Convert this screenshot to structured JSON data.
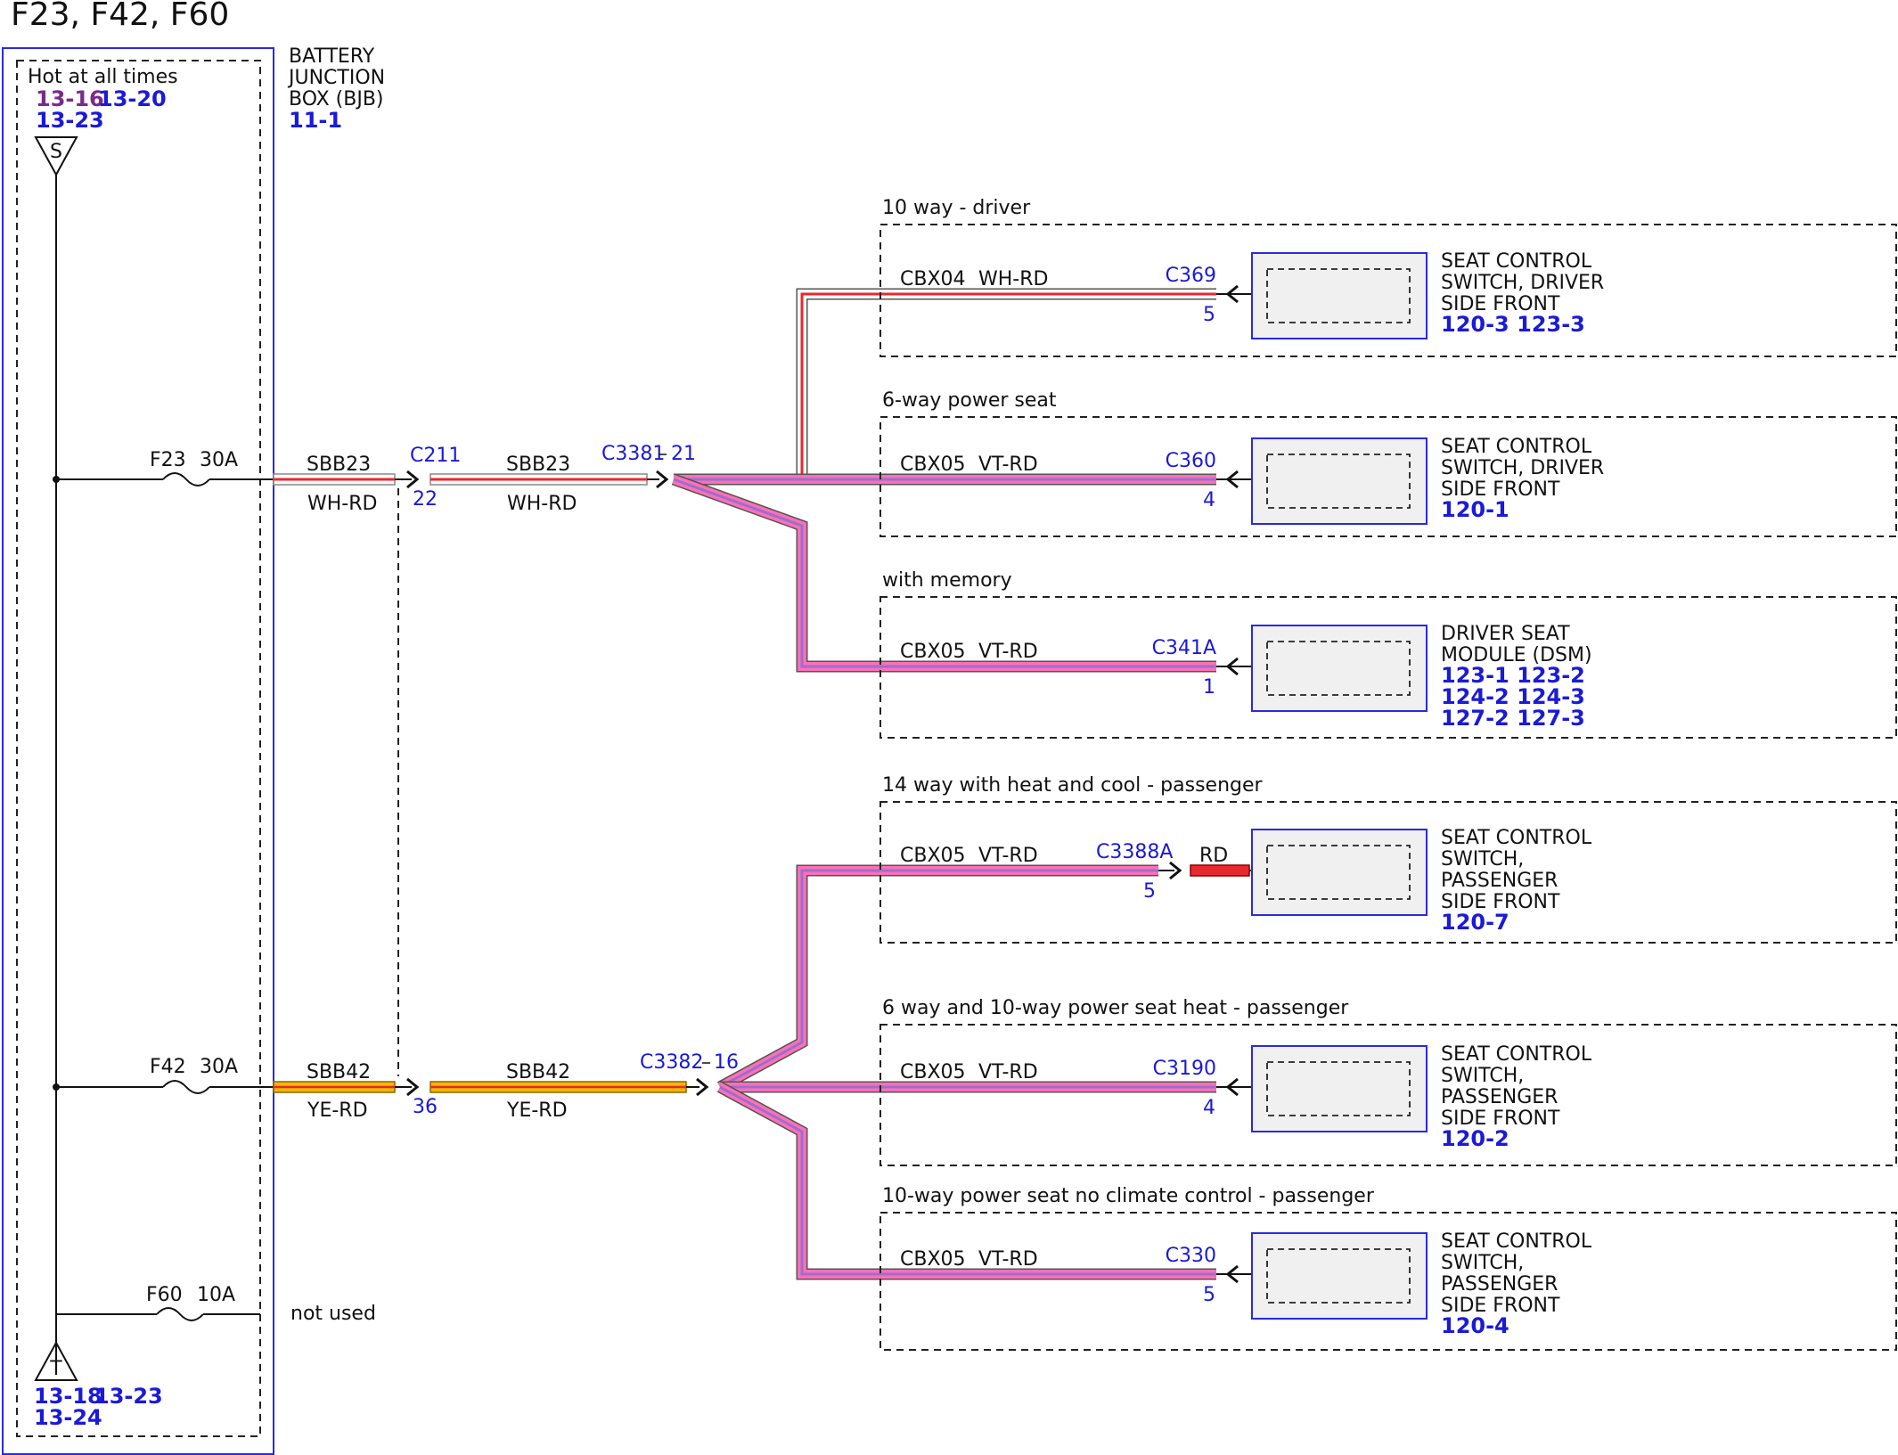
{
  "title": "F23, F42, F60",
  "colors": {
    "connector_blue": "#1a1ad8",
    "purple_ref": "#7a2a8a",
    "wire_pink": "#ff6fb5",
    "wire_red": "#e8292f",
    "wire_yellow": "#f2b705",
    "wire_violet": "#9a6fd0",
    "box_blue_border": "#2a2ae0",
    "module_fill": "#f0f0f0"
  },
  "bjb": {
    "name_lines": [
      "BATTERY",
      "JUNCTION",
      "BOX (BJB)"
    ],
    "ref": "11-1",
    "hot_label": "Hot at all times",
    "top_refs": {
      "purple": "13-16",
      "a": "13-20",
      "b": "13-23"
    },
    "top_terminal": "S",
    "bottom_terminal": "T",
    "bottom_refs": {
      "a": "13-18",
      "b": "13-23",
      "c": "13-24"
    }
  },
  "fuses": [
    {
      "id": "F23",
      "rating": "30A"
    },
    {
      "id": "F42",
      "rating": "30A"
    },
    {
      "id": "F60",
      "rating": "10A",
      "note": "not used"
    }
  ],
  "circuits": {
    "sbb23": {
      "circuit": "SBB23",
      "color": "WH-RD",
      "c211": "C211",
      "c211_pin": "22",
      "c3381": "C3381",
      "c3381_pin": "21"
    },
    "sbb42": {
      "circuit": "SBB42",
      "color": "YE-RD",
      "c211_pin": "36",
      "c3382": "C3382",
      "c3382_pin": "16"
    }
  },
  "branches": [
    {
      "header": "10 way - driver",
      "wire": "CBX04",
      "wcolor": "WH-RD",
      "connector": "C369",
      "pin": "5",
      "component": [
        "SEAT CONTROL",
        "SWITCH, DRIVER",
        "SIDE FRONT"
      ],
      "refs": [
        "120-3 123-3"
      ]
    },
    {
      "header": "6-way power seat",
      "wire": "CBX05",
      "wcolor": "VT-RD",
      "connector": "C360",
      "pin": "4",
      "component": [
        "SEAT CONTROL",
        "SWITCH, DRIVER",
        "SIDE FRONT"
      ],
      "refs": [
        "120-1"
      ]
    },
    {
      "header": "with memory",
      "wire": "CBX05",
      "wcolor": "VT-RD",
      "connector": "C341A",
      "pin": "1",
      "component": [
        "DRIVER SEAT",
        "MODULE (DSM)"
      ],
      "refs": [
        "123-1 123-2",
        "124-2 124-3",
        "127-2 127-3"
      ]
    },
    {
      "header": "14 way with heat and cool - passenger",
      "wire": "CBX05",
      "wcolor": "VT-RD",
      "connector": "C3388A",
      "pin": "5",
      "extra_color": "RD",
      "component": [
        "SEAT CONTROL",
        "SWITCH,",
        "PASSENGER",
        "SIDE FRONT"
      ],
      "refs": [
        "120-7"
      ]
    },
    {
      "header": "6 way and 10-way power seat heat - passenger",
      "wire": "CBX05",
      "wcolor": "VT-RD",
      "connector": "C3190",
      "pin": "4",
      "component": [
        "SEAT CONTROL",
        "SWITCH,",
        "PASSENGER",
        "SIDE FRONT"
      ],
      "refs": [
        "120-2"
      ]
    },
    {
      "header": "10-way power seat no climate control - passenger",
      "wire": "CBX05",
      "wcolor": "VT-RD",
      "connector": "C330",
      "pin": "5",
      "component": [
        "SEAT CONTROL",
        "SWITCH,",
        "PASSENGER",
        "SIDE FRONT"
      ],
      "refs": [
        "120-4"
      ]
    }
  ]
}
